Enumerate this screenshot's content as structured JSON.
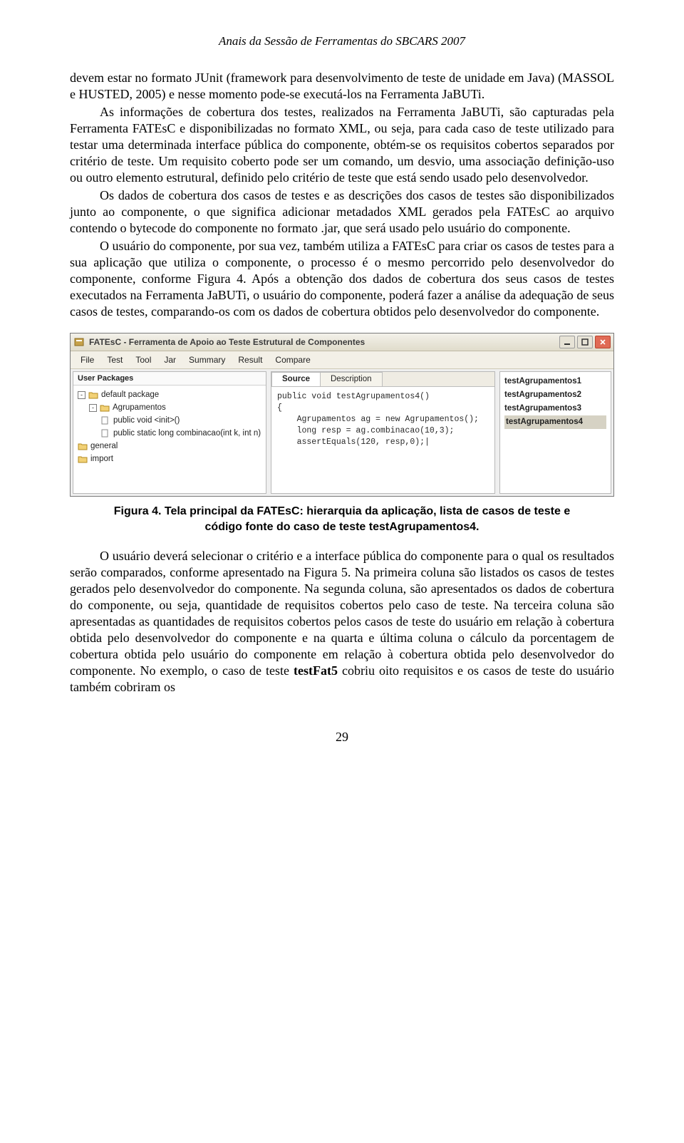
{
  "header": {
    "running": "Anais da Sessão de Ferramentas do SBCARS 2007"
  },
  "paragraphs": {
    "p1": "devem estar no formato JUnit (framework para desenvolvimento de teste de unidade em Java) (MASSOL e HUSTED, 2005) e nesse momento pode-se executá-los na Ferramenta JaBUTi.",
    "p2": "As informações de cobertura dos testes, realizados na Ferramenta JaBUTi, são capturadas pela Ferramenta FATEsC e disponibilizadas no formato XML, ou seja, para cada caso de teste utilizado para testar uma determinada interface pública do componente, obtém-se os requisitos cobertos separados por critério de teste. Um requisito coberto pode ser um comando, um desvio, uma associação definição-uso ou outro elemento estrutural, definido pelo critério de teste que está sendo usado pelo desenvolvedor.",
    "p3": "Os dados de cobertura dos casos de testes e as descrições dos casos de testes são disponibilizados junto ao componente, o que significa adicionar metadados XML gerados pela FATEsC ao arquivo contendo o bytecode do componente no formato .jar, que será usado pelo usuário do componente.",
    "p4": "O usuário do componente, por sua vez, também utiliza a FATEsC para criar os casos de testes para a sua aplicação que utiliza o componente, o processo é o mesmo percorrido pelo desenvolvedor do componente, conforme Figura 4. Após a obtenção dos dados de cobertura dos seus casos de testes executados na Ferramenta JaBUTi, o usuário do componente, poderá fazer a análise da adequação de seus casos de testes, comparando-os com os dados de cobertura obtidos pelo desenvolvedor do componente.",
    "p5a": "O usuário deverá selecionar o critério e a interface pública do componente para o qual os resultados serão comparados, conforme apresentado na Figura 5. Na primeira coluna são listados os casos de testes gerados pelo desenvolvedor do componente. Na segunda coluna, são apresentados os dados de cobertura do componente, ou seja, quantidade de requisitos cobertos pelo caso de teste.  Na terceira coluna são apresentadas as quantidades de requisitos cobertos pelos casos de teste do usuário em relação à cobertura obtida pelo desenvolvedor do componente e na quarta e última coluna o cálculo da porcentagem de cobertura obtida pelo usuário do componente em relação à cobertura obtida pelo desenvolvedor do componente. No exemplo, o caso de teste ",
    "p5b": "testFat5",
    "p5c": " cobriu oito requisitos e os casos de teste do usuário também cobriram os"
  },
  "figure": {
    "caption": "Figura 4. Tela principal da FATEsC: hierarquia da aplicação, lista de casos de teste e código fonte do caso de teste testAgrupamentos4.",
    "window": {
      "title": "FATEsC - Ferramenta de Apoio ao Teste Estrutural de Componentes",
      "menus": [
        "File",
        "Test",
        "Tool",
        "Jar",
        "Summary",
        "Result",
        "Compare"
      ],
      "left": {
        "header": "User Packages",
        "tree": [
          {
            "depth": 0,
            "toggle": "-",
            "icon": "folder",
            "label": "default package"
          },
          {
            "depth": 1,
            "toggle": "-",
            "icon": "folder",
            "label": "Agrupamentos"
          },
          {
            "depth": 2,
            "toggle": "",
            "icon": "file",
            "label": "public void <init>()"
          },
          {
            "depth": 2,
            "toggle": "",
            "icon": "file",
            "label": "public static long combinacao(int k, int n)"
          },
          {
            "depth": 0,
            "toggle": "",
            "icon": "folder",
            "label": "general"
          },
          {
            "depth": 0,
            "toggle": "",
            "icon": "folder",
            "label": "import"
          }
        ]
      },
      "center": {
        "tabs": [
          {
            "label": "Source",
            "active": true
          },
          {
            "label": "Description",
            "active": false
          }
        ],
        "source": "public void testAgrupamentos4()\n{\n    Agrupamentos ag = new Agrupamentos();\n    long resp = ag.combinacao(10,3);\n    assertEquals(120, resp,0);|\n"
      },
      "right": {
        "items": [
          "testAgrupamentos1",
          "testAgrupamentos2",
          "testAgrupamentos3",
          "testAgrupamentos4"
        ],
        "selected_index": 3
      }
    }
  },
  "page_number": "29"
}
